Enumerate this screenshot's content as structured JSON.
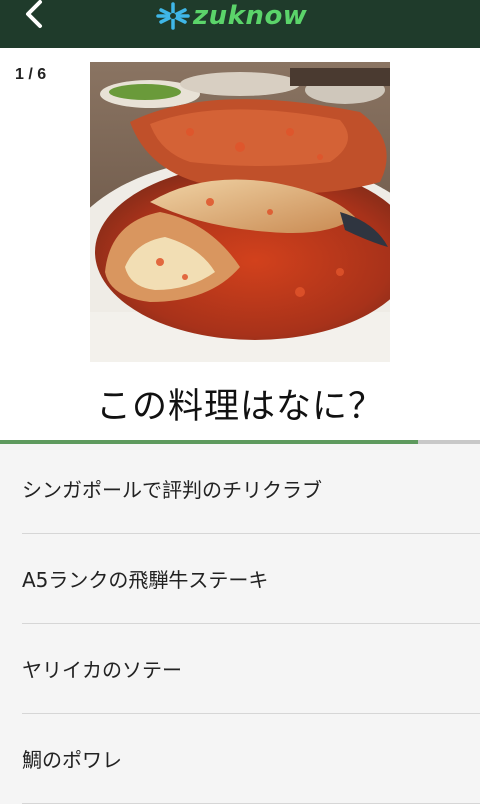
{
  "header": {
    "logo_text": "zuknow",
    "logo_color": "#5bd46a",
    "bg_color": "#1f3b2b",
    "back_icon": "chevron-left-icon"
  },
  "quiz": {
    "counter": "1 / 6",
    "question": "この料理はなに？",
    "progress": 0.87,
    "answers": [
      "シンガポールで評判のチリクラブ",
      "A5ランクの飛騨牛ステーキ",
      "ヤリイカのソテー",
      "鯛のポワレ"
    ]
  }
}
